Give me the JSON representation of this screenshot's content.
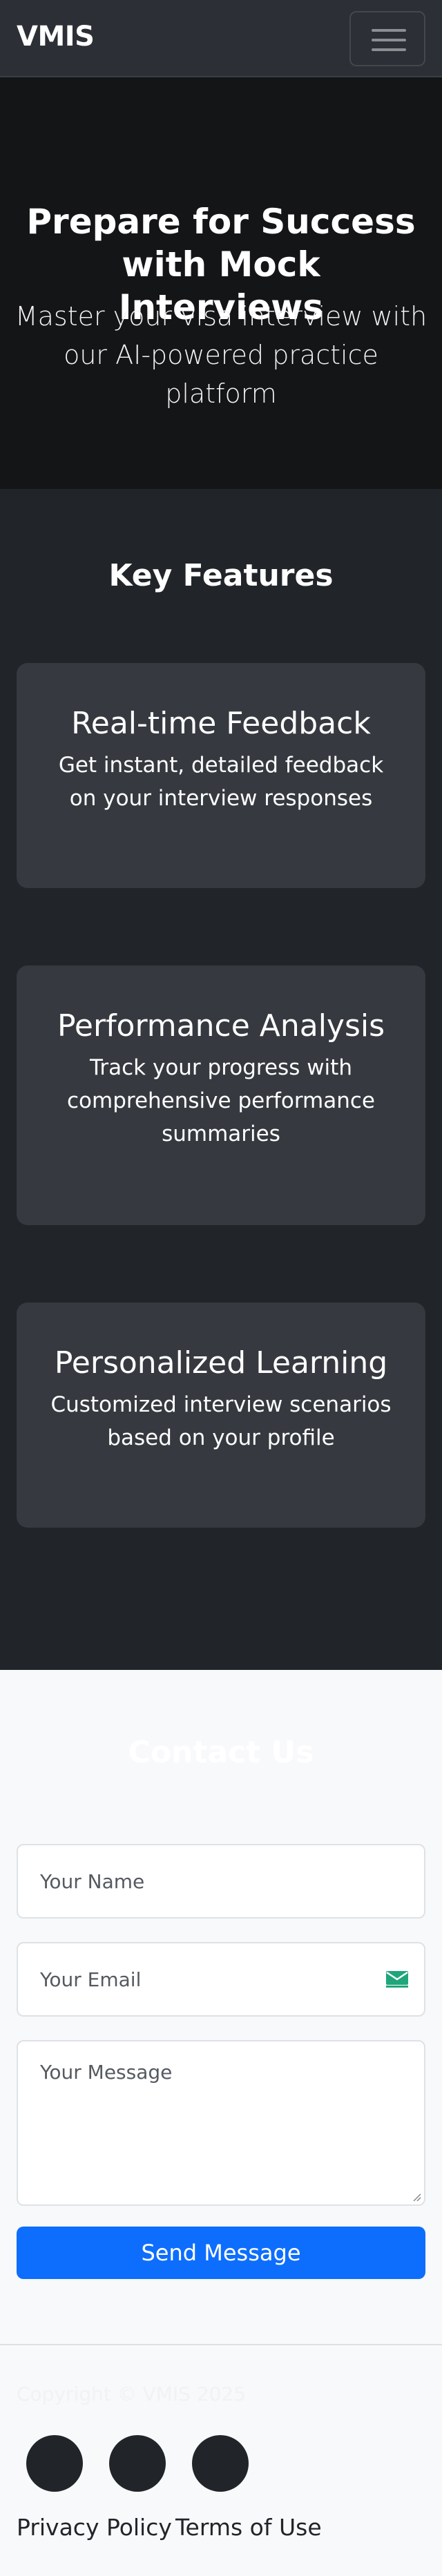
{
  "nav": {
    "brand": "VMIS"
  },
  "hero": {
    "title": "Prepare for Success with Mock Interviews",
    "subtitle": "Master your visa interview with our AI-powered practice platform"
  },
  "features": {
    "heading": "Key Features",
    "items": [
      {
        "title": "Real-time Feedback",
        "description": "Get instant, detailed feedback on your interview responses"
      },
      {
        "title": "Performance Analysis",
        "description": "Track your progress with comprehensive performance summaries"
      },
      {
        "title": "Personalized Learning",
        "description": "Customized interview scenarios based on your profile"
      }
    ]
  },
  "contact": {
    "heading": "Contact Us",
    "name_placeholder": "Your Name",
    "email_placeholder": "Your Email",
    "message_placeholder": "Your Message",
    "submit_label": "Send Message"
  },
  "footer": {
    "copyright": "Copyright © VMIS 2025",
    "links": [
      "Privacy Policy",
      "Terms of Use"
    ]
  },
  "colors": {
    "accent": "#0d6efd",
    "dark": "#212529",
    "card": "#363a40",
    "hero": "#141517",
    "light": "#f8f9fa"
  },
  "icons": {
    "menu": "hamburger-menu-icon",
    "email_field": "mail-icon",
    "social": [
      "social-icon-1",
      "social-icon-2",
      "social-icon-3"
    ]
  }
}
